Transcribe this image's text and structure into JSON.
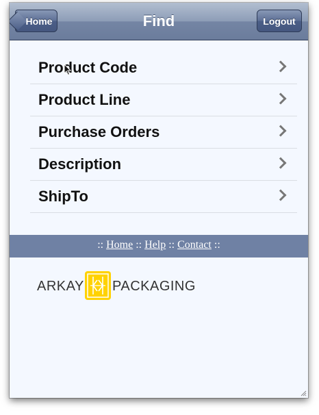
{
  "toolbar": {
    "title": "Find",
    "home_label": "Home",
    "logout_label": "Logout"
  },
  "menu": {
    "items": [
      {
        "label": "Product Code"
      },
      {
        "label": "Product Line"
      },
      {
        "label": "Purchase Orders"
      },
      {
        "label": "Description"
      },
      {
        "label": "ShipTo"
      }
    ]
  },
  "footer": {
    "sep_left": ":: ",
    "home": "Home",
    "sep1": " :: ",
    "help": "Help",
    "sep2": " :: ",
    "contact": "Contact",
    "sep_right": " ::"
  },
  "logo": {
    "left_word": "ARKAY",
    "right_word": "PACKAGING",
    "mark_color": "#ffd200"
  },
  "icons": {
    "back": "chevron-left-icon",
    "disclosure": "chevron-right-icon",
    "resize": "resize-grip-icon",
    "pointer": "mouse-cursor-icon"
  }
}
